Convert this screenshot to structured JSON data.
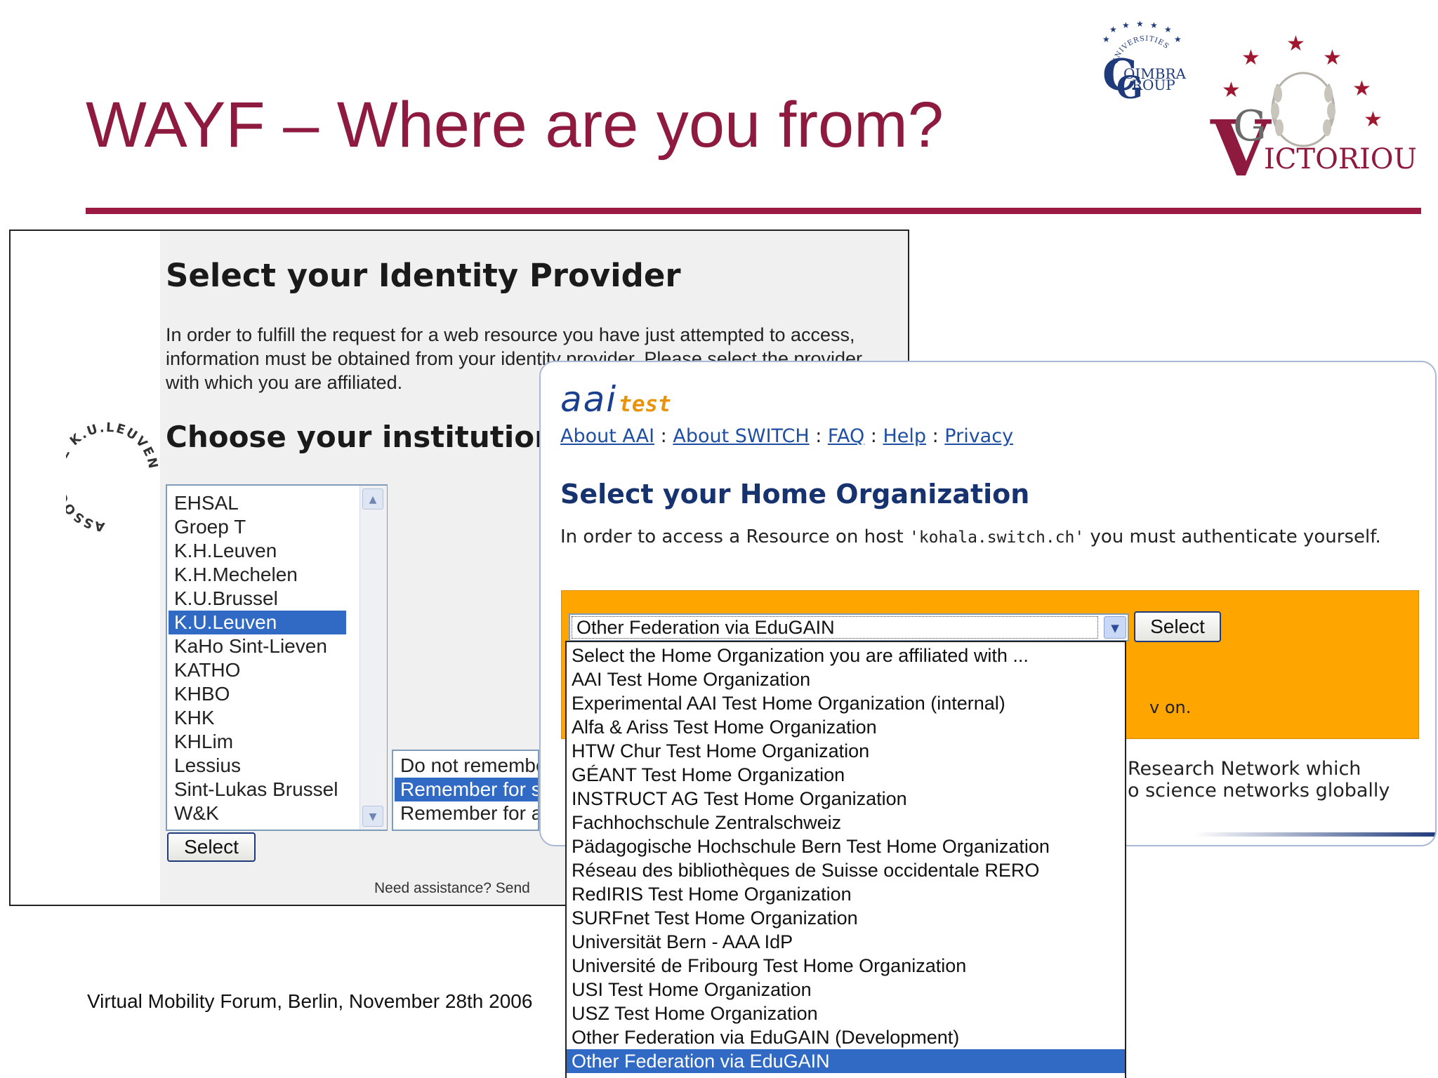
{
  "slide": {
    "title": "WAYF – Where are you from?",
    "footer": "Virtual Mobility Forum, Berlin, November 28th 2006"
  },
  "logos": {
    "coimbra_arc": "UNIVERSITIES",
    "coimbra_line1": "OIMBRA",
    "coimbra_line2": "ROUP",
    "victorious_text": "ICTORIOUS",
    "kuleuven_arc": "ASSOCIATIE K.U.LEUVEN"
  },
  "wayf": {
    "heading": "Select your Identity Provider",
    "intro": "In order to fulfill the request for a web resource you have just attempted to access, information must be obtained from your identity provider. Please select the provider with which you are affiliated.",
    "choose_heading": "Choose your institution",
    "institutions": [
      "EHSAL",
      "Groep T",
      "K.H.Leuven",
      "K.H.Mechelen",
      "K.U.Brussel",
      "K.U.Leuven",
      "KaHo Sint-Lieven",
      "KATHO",
      "KHBO",
      "KHK",
      "KHLim",
      "Lessius",
      "Sint-Lukas Brussel",
      "W&K"
    ],
    "selected_institution": "K.U.Leuven",
    "select_button": "Select",
    "remember_options": [
      "Do not remember",
      "Remember for session",
      "Remember for a week"
    ],
    "selected_remember": "Remember for session",
    "need_assistance": "Need assistance? Send"
  },
  "aai": {
    "logo_main": "aai",
    "logo_sub": "test",
    "nav": [
      "About AAI",
      "About SWITCH",
      "FAQ",
      "Help",
      "Privacy"
    ],
    "nav_separator": " : ",
    "heading": "Select your Home Organization",
    "text_before": "In order to access a Resource on host ",
    "host": "'kohala.switch.ch'",
    "text_after": " you must authenticate yourself.",
    "selected_org": "Other Federation via EduGAIN",
    "select_button": "Select",
    "orange_tail": "v on.",
    "federation_line1": "Research Network which",
    "federation_line2": "o science networks globally",
    "organizations": [
      "Select the Home Organization you are affiliated with ...",
      "AAI Test Home Organization",
      "Experimental AAI Test Home Organization (internal)",
      "Alfa & Ariss Test Home Organization",
      "HTW Chur Test Home Organization",
      "GÉANT Test Home Organization",
      "INSTRUCT AG Test Home Organization",
      "Fachhochschule Zentralschweiz",
      "Pädagogische Hochschule Bern Test Home Organization",
      "Réseau des bibliothèques de Suisse occidentale RERO",
      "RedIRIS Test Home Organization",
      "SURFnet Test Home Organization",
      "Universität Bern - AAA IdP",
      "Université de Fribourg Test Home Organization",
      "USI Test Home Organization",
      "USZ Test Home Organization",
      "Other Federation via EduGAIN (Development)",
      "Other Federation via EduGAIN"
    ]
  },
  "colors": {
    "title": "#8e1b3f",
    "rule": "#9a1a43",
    "highlight": "#316ac5",
    "orange": "#ffa500",
    "aai_blue": "#1a3f8f"
  },
  "icons": {
    "scroll_up": "chevron-up-icon",
    "scroll_down": "chevron-down-icon",
    "dropdown": "chevron-down-icon"
  }
}
